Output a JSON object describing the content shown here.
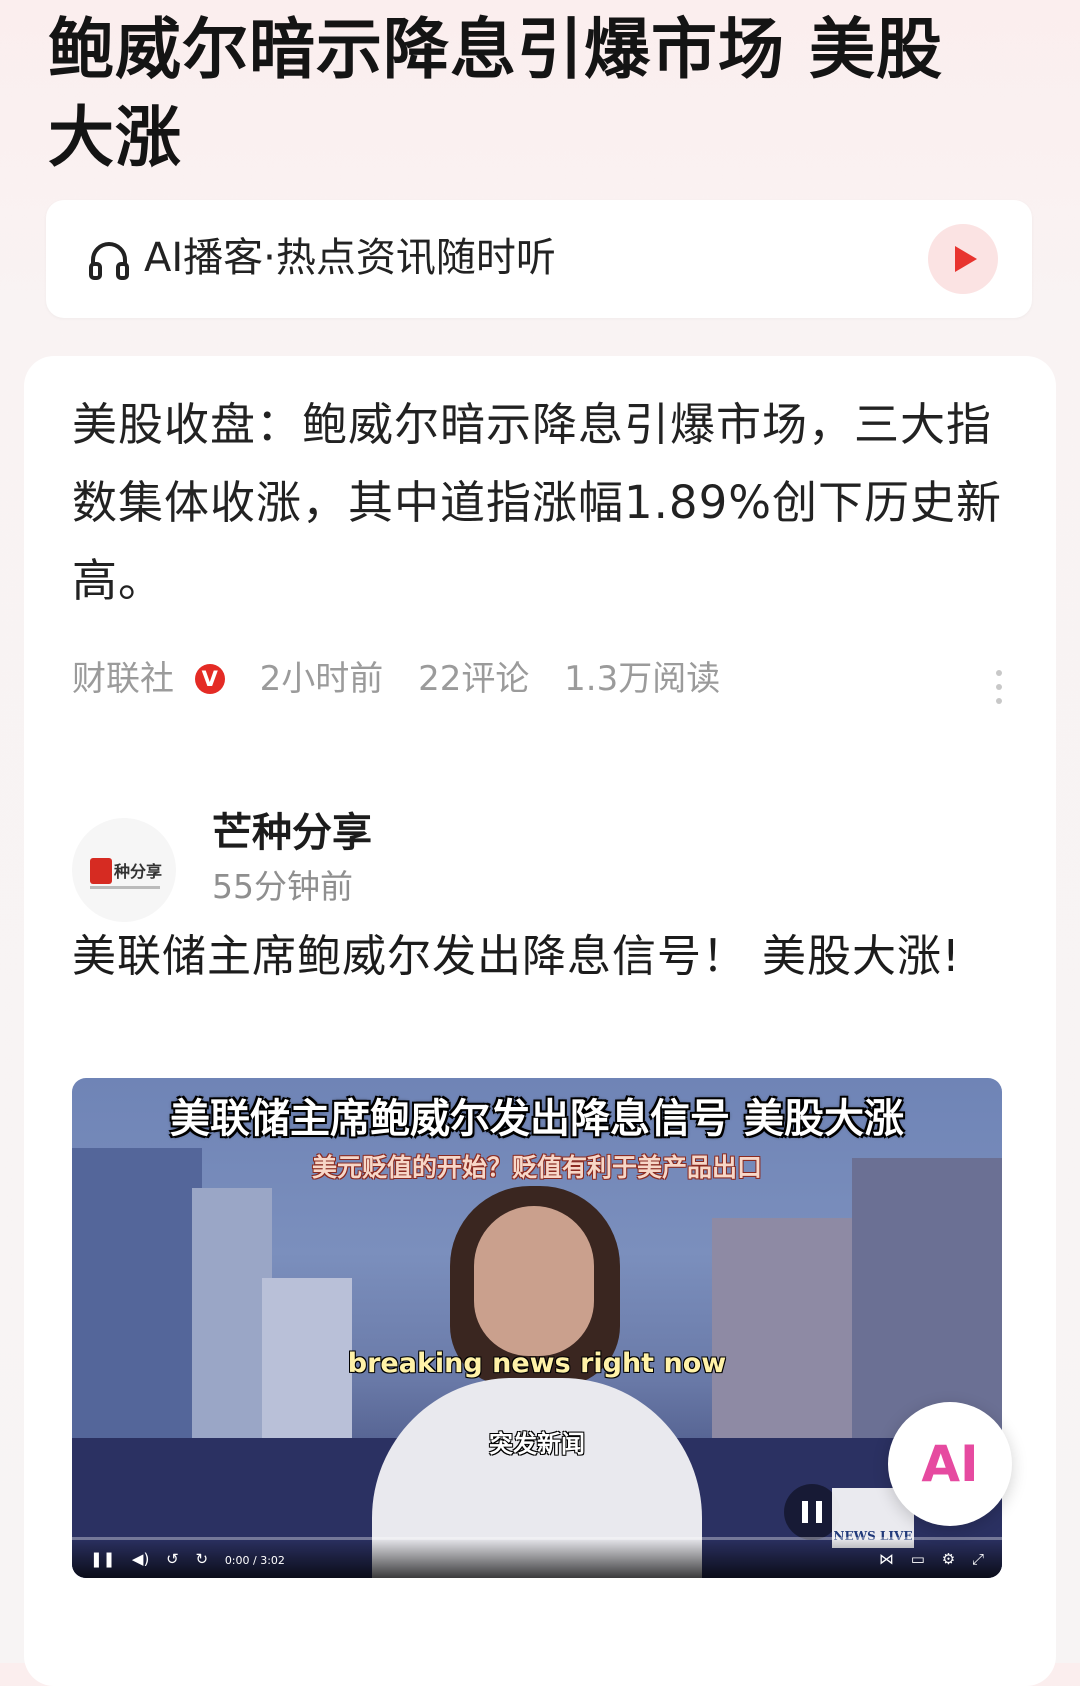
{
  "article": {
    "headline": "鲍威尔暗示降息引爆市场 美股大涨"
  },
  "podcast": {
    "label": "AI播客·热点资讯随时听",
    "icon": "headphones-icon",
    "play_icon": "play-icon",
    "accent": "#e8342f"
  },
  "summary": {
    "text": "美股收盘：鲍威尔暗示降息引爆市场，三大指数集体收涨，其中道指涨幅1.89%创下历史新高。",
    "source": "财联社",
    "verified_badge": "V",
    "time": "2小时前",
    "comments": "22评论",
    "reads": "1.3万阅读"
  },
  "post": {
    "author": "芒种分享",
    "time": "55分钟前",
    "title": "美联储主席鲍威尔发出降息信号！ 美股大涨!",
    "video": {
      "caption_title": "美联储主席鲍威尔发出降息信号 美股大涨",
      "caption_sub": "美元贬值的开始？贬值有利于美产品出口",
      "caption_en": "breaking news right now",
      "caption_zh": "突发新闻",
      "time": "0:00 / 3:02",
      "badge": "NEWS LIVE"
    }
  },
  "fab": {
    "label": "AI"
  }
}
